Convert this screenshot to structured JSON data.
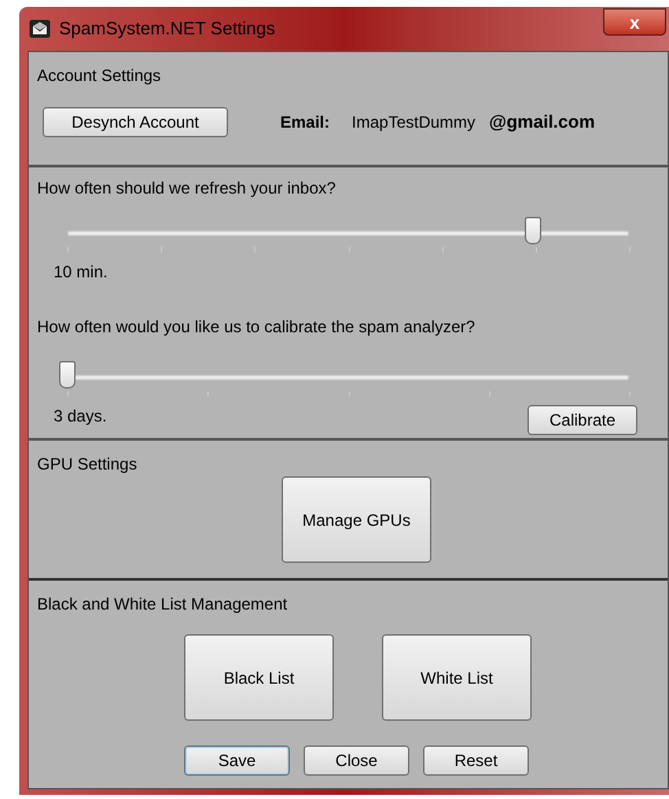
{
  "window": {
    "title": "SpamSystem.NET Settings",
    "close": "x"
  },
  "account": {
    "heading": "Account Settings",
    "desynch_button": "Desynch Account",
    "email_label": "Email:",
    "email_user": "ImapTestDummy",
    "email_domain": "@gmail.com"
  },
  "refresh": {
    "question": "How often should we refresh your inbox?",
    "level": 0.83,
    "reading": "10 min."
  },
  "calibration": {
    "question": "How often would you like us to calibrate the spam analyzer?",
    "level": 0,
    "reading": "3 days.",
    "button": "Calibrate"
  },
  "gpu": {
    "heading": "GPU Settings",
    "button": "Manage GPUs"
  },
  "lists": {
    "heading": "Black and White List Management",
    "buttons": [
      "Black List",
      "White List"
    ]
  },
  "footer_buttons": [
    {
      "label": "Save",
      "default": true
    },
    {
      "label": "Close",
      "default": false
    },
    {
      "label": "Reset",
      "default": false
    }
  ]
}
